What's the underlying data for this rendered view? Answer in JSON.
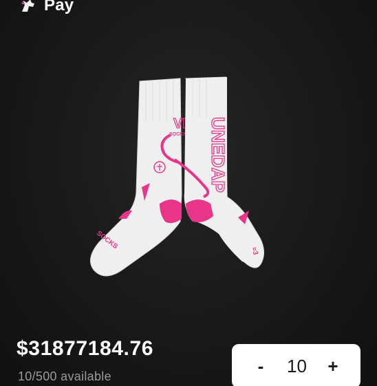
{
  "header": {
    "brand_icon": "unicorn-icon",
    "title": "Pay"
  },
  "product": {
    "image": "white-pink-socks-photo",
    "sock_text_left": "VLO SOCKS",
    "sock_text_right": "UNEDAP",
    "price": "$31877184.76",
    "availability": "10/500 available"
  },
  "quantity": {
    "minus_label": "-",
    "value": "10",
    "plus_label": "+"
  },
  "colors": {
    "background": "#141414",
    "accent": "#e8358a",
    "sock_white": "#efefef"
  }
}
